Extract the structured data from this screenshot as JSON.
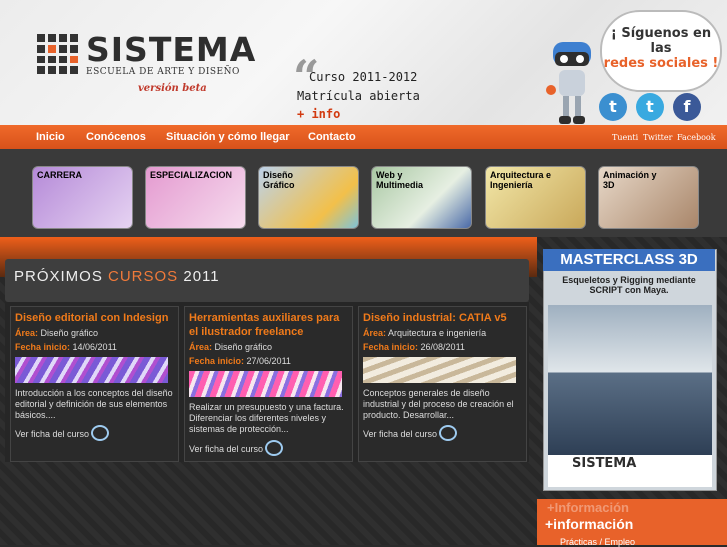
{
  "logo": {
    "title": "SISTEMA",
    "subtitle": "ESCUELA DE ARTE Y DISEÑO",
    "beta": "versión beta"
  },
  "promo": {
    "line1": "Curso 2011-2012",
    "line2": "Matrícula abierta",
    "line3": "+ info"
  },
  "social_bubble": {
    "line1": "¡ Síguenos en las",
    "line2": "redes sociales !"
  },
  "social": [
    {
      "label": "Tuenti",
      "icon": "tuenti-icon",
      "color": "#3b8fd0"
    },
    {
      "label": "Twitter",
      "icon": "twitter-icon",
      "color": "#39a9e0"
    },
    {
      "label": "Facebook",
      "icon": "facebook-icon",
      "color": "#3b5998"
    }
  ],
  "nav": [
    "Inicio",
    "Conócenos",
    "Situación y cómo llegar",
    "Contacto"
  ],
  "categories": [
    {
      "label": "CARRERA",
      "bg": "#c9a8e0"
    },
    {
      "label": "ESPECIALIZACION",
      "bg": "#e9b4d9"
    },
    {
      "label": "Diseño Gráfico",
      "bg": "#d6e2ef"
    },
    {
      "label": "Web y Multimedia",
      "bg": "#c8d9c3"
    },
    {
      "label": "Arquitectura e Ingeniería",
      "bg": "#efe6b0"
    },
    {
      "label": "Animación y 3D",
      "bg": "#d9c7b5"
    }
  ],
  "courses_panel": {
    "title_a": "PRÓXIMOS ",
    "title_b": "CURSOS",
    "title_c": " 2011"
  },
  "courses": [
    {
      "title": "Diseño editorial con Indesign",
      "area_label": "Área:",
      "area": "Diseño gráfico",
      "date_label": "Fecha inicio:",
      "date": "14/06/2011",
      "desc": "Introducción a los conceptos del diseño editorial y definición de sus elementos básicos....",
      "link": "Ver ficha del curso"
    },
    {
      "title": "Herramientas auxiliares para el ilustrador freelance",
      "area_label": "Área:",
      "area": "Diseño gráfico",
      "date_label": "Fecha inicio:",
      "date": "27/06/2011",
      "desc": "Realizar un presupuesto y una factura. Diferenciar los diferentes niveles y sistemas de protección...",
      "link": "Ver ficha del curso"
    },
    {
      "title": "Diseño industrial: CATIA v5",
      "area_label": "Área:",
      "area": "Arquitectura e ingeniería",
      "date_label": "Fecha inicio:",
      "date": "26/08/2011",
      "desc": "Conceptos generales de diseño industrial y del proceso de creación el producto. Desarrollar...",
      "link": "Ver ficha del curso"
    }
  ],
  "masterclass": {
    "title": "MASTERCLASS 3D",
    "subtitle": "Esqueletos y Rigging mediante SCRIPT con Maya.",
    "logo": "SISTEMA"
  },
  "info": {
    "ghost": "+Información",
    "main": "+información",
    "sub": "Prácticas / Empleo"
  }
}
